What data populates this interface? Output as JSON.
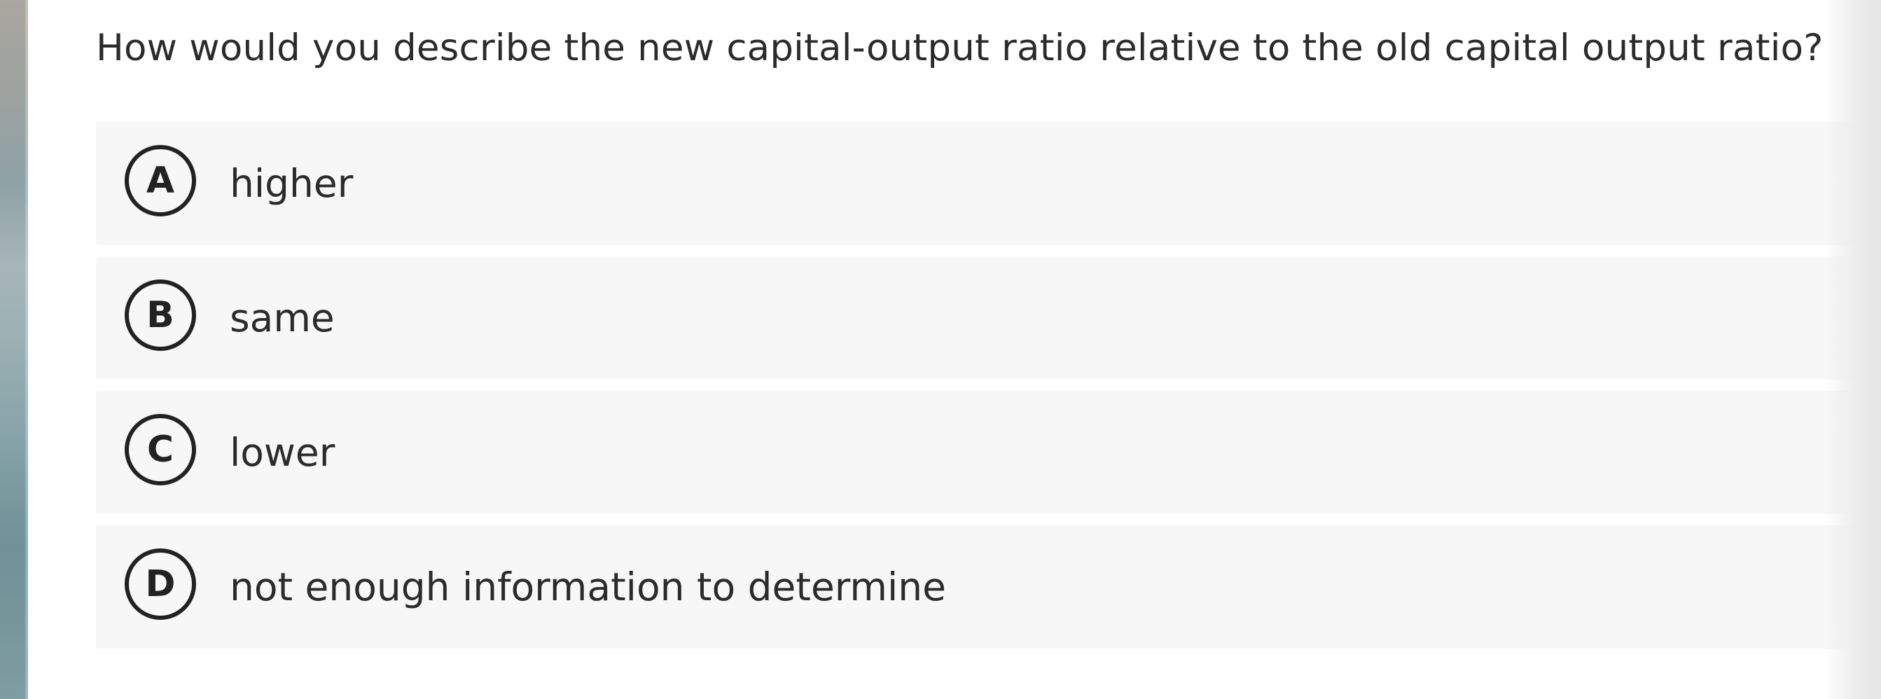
{
  "question": {
    "text": "How would you describe the new capital-output ratio relative to the old capital output ratio?"
  },
  "options": [
    {
      "letter": "A",
      "label": "higher"
    },
    {
      "letter": "B",
      "label": "same"
    },
    {
      "letter": "C",
      "label": "lower"
    },
    {
      "letter": "D",
      "label": "not enough information to determine"
    }
  ],
  "colors": {
    "text": "#2b2b2b",
    "option_background": "#f7f7f7",
    "letter_border": "#222222"
  }
}
